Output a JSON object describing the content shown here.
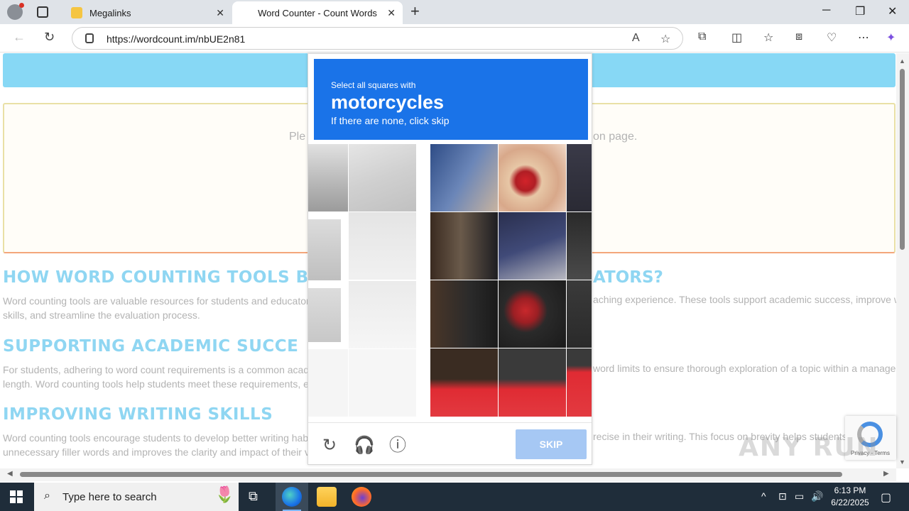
{
  "browser": {
    "tabs": [
      {
        "label": "Megalinks",
        "active": false
      },
      {
        "label": "Word Counter - Count Words",
        "active": true
      }
    ],
    "url": "https://wordcount.im/nbUE2n81"
  },
  "page": {
    "editor_hint_left": "Ple",
    "editor_hint_right": "on page.",
    "sections": [
      {
        "heading_left": "HOW WORD COUNTING TOOLS B",
        "heading_right": "ATORS?",
        "para_line1_left": "Word counting tools are valuable resources for students and educator",
        "para_line1_right": "aching experience. These tools support academic success, improve w",
        "para_line2": "skills, and streamline the evaluation process."
      },
      {
        "heading_left": "SUPPORTING ACADEMIC SUCCE",
        "heading_right": "",
        "para_line1_left": "For students, adhering to word count requirements is a common acad",
        "para_line1_right": "word limits to ensure thorough exploration of a topic within a manage",
        "para_line2": "length. Word counting tools help students meet these requirements, e"
      },
      {
        "heading_left": "IMPROVING WRITING SKILLS",
        "heading_right": "",
        "para_line1_left": "Word counting tools encourage students to develop better writing hab",
        "para_line1_right": "recise in their writing. This focus on brevity helps students",
        "para_line2": "unnecessary filler words and improves the clarity and impact of their v"
      }
    ]
  },
  "captcha": {
    "instruction": "Select all squares with",
    "target": "motorcycles",
    "hint": "If there are none, click skip",
    "skip_label": "SKIP",
    "icons": [
      "reload-icon",
      "audio-icon",
      "info-icon"
    ]
  },
  "recaptcha_badge": {
    "text": "Privacy - Terms"
  },
  "watermark": "ANY RUN",
  "taskbar": {
    "search_placeholder": "Type here to search",
    "time": "6:13 PM",
    "date": "6/22/2025"
  },
  "colors": {
    "captcha_header": "#1a73e8",
    "skip_button": "#a6c8f4",
    "heading": "#8fd6f2",
    "top_band": "#87d8f5"
  }
}
